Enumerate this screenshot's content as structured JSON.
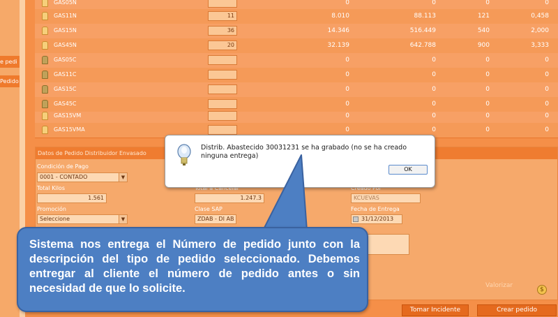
{
  "sidebar": {
    "items": [
      {
        "label": "e pedi"
      },
      {
        "label": "Pedido"
      }
    ]
  },
  "grid": {
    "rows": [
      {
        "name": "GAS05N",
        "qty": "",
        "c1": "0",
        "c2": "0",
        "c3": "0",
        "c4": "0"
      },
      {
        "name": "GAS11N",
        "qty": "11",
        "c1": "8.010",
        "c2": "88.113",
        "c3": "121",
        "c4": "0,458"
      },
      {
        "name": "GAS15N",
        "qty": "36",
        "c1": "14.346",
        "c2": "516.449",
        "c3": "540",
        "c4": "2,000"
      },
      {
        "name": "GAS45N",
        "qty": "20",
        "c1": "32.139",
        "c2": "642.788",
        "c3": "900",
        "c4": "3,333"
      },
      {
        "name": "GAS05C",
        "qty": "",
        "c1": "0",
        "c2": "0",
        "c3": "0",
        "c4": "0"
      },
      {
        "name": "GAS11C",
        "qty": "",
        "c1": "0",
        "c2": "0",
        "c3": "0",
        "c4": "0"
      },
      {
        "name": "GAS15C",
        "qty": "",
        "c1": "0",
        "c2": "0",
        "c3": "0",
        "c4": "0"
      },
      {
        "name": "GAS45C",
        "qty": "",
        "c1": "0",
        "c2": "0",
        "c3": "0",
        "c4": "0"
      },
      {
        "name": "GAS15VM",
        "qty": "",
        "c1": "0",
        "c2": "0",
        "c3": "0",
        "c4": "0"
      },
      {
        "name": "GAS15VMA",
        "qty": "",
        "c1": "0",
        "c2": "0",
        "c3": "0",
        "c4": "0"
      }
    ]
  },
  "form": {
    "title": "Datos de Pedido Distribuidor Envasado",
    "condicion_label": "Condición de Pago",
    "condicion_value": "0001 - CONTADO",
    "total_kilos_label": "Total Kilos",
    "total_kilos_value": "1.561",
    "total_cancelar_label": "Total a Cancelar",
    "total_cancelar_value": "1.247.3",
    "creado_por_label": "Creado Por",
    "creado_por_value": "KCUEVAS",
    "promocion_label": "Promoción",
    "promocion_value": "Seleccione",
    "clase_sap_label": "Clase SAP",
    "clase_sap_value": "ZDAB - DI AB",
    "fecha_entrega_label": "Fecha de Entrega",
    "fecha_entrega_value": "31/12/2013",
    "valorizar_label": "Valorizar",
    "tomar_incidente_label": "Tomar Incidente",
    "crear_pedido_label": "Crear pedido"
  },
  "modal": {
    "message": "Distrib. Abastecido 30031231 se ha grabado (no se ha creado ninguna entrega)",
    "ok_label": "OK"
  },
  "callout": {
    "text": "Sistema nos entrega el Número de pedido junto con la descripción del tipo de pedido seleccionado. Debemos entregar al cliente el número de pedido antes o sin necesidad de que lo solicite."
  },
  "colors": {
    "panel": "#f58f48",
    "callout": "#4d7fc3",
    "button": "#e56a1e"
  }
}
